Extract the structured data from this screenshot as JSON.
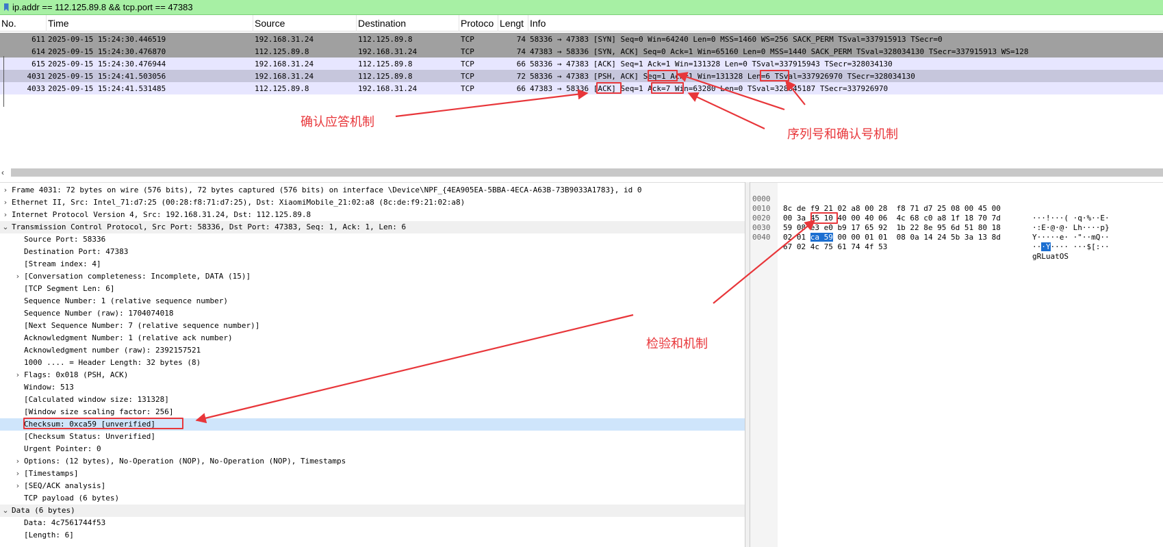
{
  "filter": {
    "value": "ip.addr == 112.125.89.8 && tcp.port == 47383"
  },
  "packet_list": {
    "columns": [
      "No.",
      "Time",
      "Source",
      "Destination",
      "Protoco",
      "Lengt",
      "Info"
    ],
    "rows": [
      {
        "no": "611",
        "time": "2025-09-15 15:24:30.446519",
        "src": "192.168.31.24",
        "dst": "112.125.89.8",
        "proto": "TCP",
        "len": "74",
        "info": "58336 → 47383 [SYN] Seq=0 Win=64240 Len=0 MSS=1460 WS=256 SACK_PERM TSval=337915913 TSecr=0"
      },
      {
        "no": "614",
        "time": "2025-09-15 15:24:30.476870",
        "src": "112.125.89.8",
        "dst": "192.168.31.24",
        "proto": "TCP",
        "len": "74",
        "info": "47383 → 58336 [SYN, ACK] Seq=0 Ack=1 Win=65160 Len=0 MSS=1440 SACK_PERM TSval=328034130 TSecr=337915913 WS=128"
      },
      {
        "no": "615",
        "time": "2025-09-15 15:24:30.476944",
        "src": "192.168.31.24",
        "dst": "112.125.89.8",
        "proto": "TCP",
        "len": "66",
        "info": "58336 → 47383 [ACK] Seq=1 Ack=1 Win=131328 Len=0 TSval=337915943 TSecr=328034130"
      },
      {
        "no": "4031",
        "time": "2025-09-15 15:24:41.503056",
        "src": "192.168.31.24",
        "dst": "112.125.89.8",
        "proto": "TCP",
        "len": "72",
        "info": "58336 → 47383 [PSH, ACK] Seq=1 Ack=1 Win=131328 Len=6 TSval=337926970 TSecr=328034130"
      },
      {
        "no": "4033",
        "time": "2025-09-15 15:24:41.531485",
        "src": "112.125.89.8",
        "dst": "192.168.31.24",
        "proto": "TCP",
        "len": "66",
        "info": "47383 → 58336 [ACK] Seq=1 Ack=7 Win=63280 Len=0 TSval=328045187 TSecr=337926970"
      }
    ]
  },
  "details": {
    "rows": [
      {
        "level": 0,
        "twisty": "›",
        "text": "Frame 4031: 72 bytes on wire (576 bits), 72 bytes captured (576 bits) on interface \\Device\\NPF_{4EA905EA-5BBA-4ECA-A63B-73B9033A1783}, id 0"
      },
      {
        "level": 0,
        "twisty": "›",
        "text": "Ethernet II, Src: Intel_71:d7:25 (00:28:f8:71:d7:25), Dst: XiaomiMobile_21:02:a8 (8c:de:f9:21:02:a8)"
      },
      {
        "level": 0,
        "twisty": "›",
        "text": "Internet Protocol Version 4, Src: 192.168.31.24, Dst: 112.125.89.8"
      },
      {
        "level": 0,
        "twisty": "⌄",
        "text": "Transmission Control Protocol, Src Port: 58336, Dst Port: 47383, Seq: 1, Ack: 1, Len: 6"
      },
      {
        "level": 1,
        "twisty": "",
        "text": "Source Port: 58336"
      },
      {
        "level": 1,
        "twisty": "",
        "text": "Destination Port: 47383"
      },
      {
        "level": 1,
        "twisty": "",
        "text": "[Stream index: 4]"
      },
      {
        "level": 1,
        "twisty": "›",
        "text": "[Conversation completeness: Incomplete, DATA (15)]"
      },
      {
        "level": 1,
        "twisty": "",
        "text": "[TCP Segment Len: 6]"
      },
      {
        "level": 1,
        "twisty": "",
        "text": "Sequence Number: 1    (relative sequence number)"
      },
      {
        "level": 1,
        "twisty": "",
        "text": "Sequence Number (raw): 1704074018"
      },
      {
        "level": 1,
        "twisty": "",
        "text": "[Next Sequence Number: 7    (relative sequence number)]"
      },
      {
        "level": 1,
        "twisty": "",
        "text": "Acknowledgment Number: 1    (relative ack number)"
      },
      {
        "level": 1,
        "twisty": "",
        "text": "Acknowledgment number (raw): 2392157521"
      },
      {
        "level": 1,
        "twisty": "",
        "text": "1000 .... = Header Length: 32 bytes (8)"
      },
      {
        "level": 1,
        "twisty": "›",
        "text": "Flags: 0x018 (PSH, ACK)"
      },
      {
        "level": 1,
        "twisty": "",
        "text": "Window: 513"
      },
      {
        "level": 1,
        "twisty": "",
        "text": "[Calculated window size: 131328]"
      },
      {
        "level": 1,
        "twisty": "",
        "text": "[Window size scaling factor: 256]"
      },
      {
        "level": 1,
        "twisty": "",
        "text": "Checksum: 0xca59 [unverified]"
      },
      {
        "level": 1,
        "twisty": "",
        "text": "[Checksum Status: Unverified]"
      },
      {
        "level": 1,
        "twisty": "",
        "text": "Urgent Pointer: 0"
      },
      {
        "level": 1,
        "twisty": "›",
        "text": "Options: (12 bytes), No-Operation (NOP), No-Operation (NOP), Timestamps"
      },
      {
        "level": 1,
        "twisty": "›",
        "text": "[Timestamps]"
      },
      {
        "level": 1,
        "twisty": "›",
        "text": "[SEQ/ACK analysis]"
      },
      {
        "level": 1,
        "twisty": "",
        "text": "TCP payload (6 bytes)"
      },
      {
        "level": 0,
        "twisty": "⌄",
        "text": "Data (6 bytes)"
      },
      {
        "level": 1,
        "twisty": "",
        "text": "Data: 4c7561744f53"
      },
      {
        "level": 1,
        "twisty": "",
        "text": "[Length: 6]"
      }
    ]
  },
  "hex": {
    "rows": [
      {
        "offset": "0000",
        "bytes": "8c de f9 21 02 a8 00 28  f8 71 d7 25 08 00 45 00",
        "ascii": "···!···( ·q·%··E·"
      },
      {
        "offset": "0010",
        "bytes": "00 3a 45 10 40 00 40 06  4c 68 c0 a8 1f 18 70 7d",
        "ascii": "·:E·@·@· Lh····p}"
      },
      {
        "offset": "0020",
        "bytes": "59 08 e3 e0 b9 17 65 92  1b 22 8e 95 6d 51 80 18",
        "ascii": "Y·····e· ·\"··mQ··"
      },
      {
        "offset": "0030",
        "bytes_before": "02 01 ",
        "bytes_hl": "ca 59",
        "bytes_after": " 00 00 01 01  08 0a 14 24 5b 3a 13 8d",
        "ascii_before": "··",
        "ascii_hl": "·Y",
        "ascii_after": "···· ···$[:··"
      },
      {
        "offset": "0040",
        "bytes": "67 02 4c 75 61 74 4f 53",
        "ascii": "gRLuatOS"
      }
    ]
  },
  "annotations": {
    "ack": "确认应答机制",
    "seq_ack": "序列号和确认号机制",
    "checksum": "检验和机制"
  },
  "colors": {
    "annotation": "#e8363a",
    "filter_bg": "#a7f0a4",
    "selected_detail": "#cfe5fb",
    "hex_highlight": "#1c6fd1"
  }
}
